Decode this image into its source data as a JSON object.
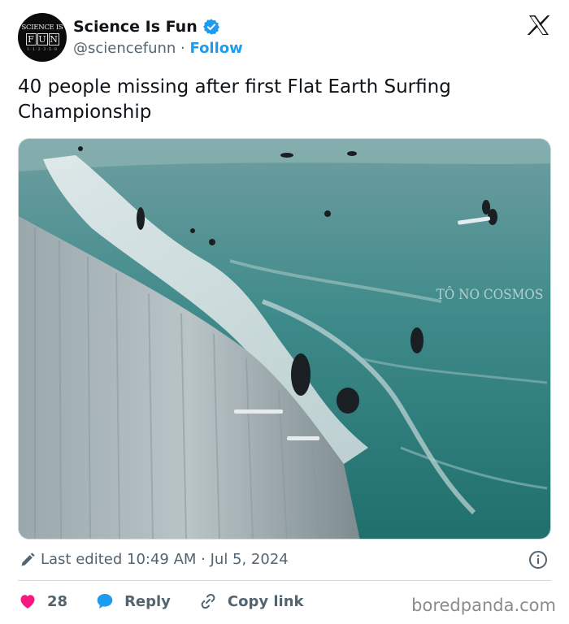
{
  "author": {
    "avatar_text": {
      "line1": "SCIENCE IS",
      "letters": [
        "F",
        "U",
        "N"
      ],
      "line3": "1·1·2·3·5·8"
    },
    "name": "Science Is Fun",
    "handle": "@sciencefunn",
    "separator": "·",
    "follow_label": "Follow"
  },
  "tweet": {
    "text": "40 people missing after first Flat Earth Surfing Championship",
    "image_watermark": "TÔ NO COSMOS"
  },
  "meta": {
    "edited_label": "Last edited 10:49 AM · Jul 5, 2024"
  },
  "actions": {
    "like_count": "28",
    "reply_label": "Reply",
    "copy_link_label": "Copy link"
  },
  "site_watermark": "boredpanda.com",
  "colors": {
    "link_blue": "#1d9bf0",
    "like_pink": "#f91880",
    "muted_gray": "#536471",
    "verified_blue": "#1d9bf0"
  },
  "icons": [
    "verified-badge-icon",
    "x-logo-icon",
    "pencil-icon",
    "info-icon",
    "heart-icon",
    "reply-bubble-icon",
    "link-icon"
  ]
}
